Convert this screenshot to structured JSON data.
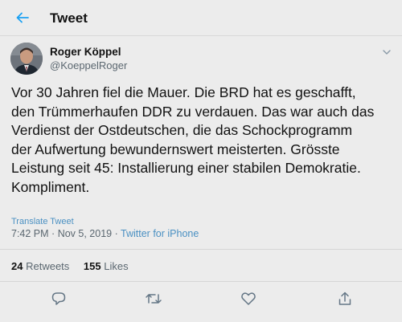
{
  "header": {
    "title": "Tweet"
  },
  "author": {
    "name": "Roger Köppel",
    "handle": "@KoeppelRoger"
  },
  "tweet": {
    "lines": [
      "Vor 30 Jahren fiel die Mauer. Die BRD hat es geschafft,",
      "den Trümmerhaufen DDR zu verdauen. Das war auch das",
      "Verdienst der Ostdeutschen, die das Schockprogramm",
      "der Aufwertung bewundernswert meisterten. Grösste",
      "Leistung seit 45: Installierung einer stabilen Demokratie.",
      "Kompliment."
    ],
    "translate_label": "Translate Tweet",
    "time": "7:42 PM",
    "date": "Nov 5, 2019",
    "separator": "·",
    "source": "Twitter for iPhone"
  },
  "stats": {
    "retweets_count": "24",
    "retweets_label": "Retweets",
    "likes_count": "155",
    "likes_label": "Likes"
  },
  "colors": {
    "background": "#ececec",
    "link": "#4a90c2",
    "accent": "#1da1f2",
    "muted": "#5b6770"
  },
  "icons": [
    "back-arrow-icon",
    "chevron-down-icon",
    "reply-icon",
    "retweet-icon",
    "like-icon",
    "share-icon"
  ]
}
